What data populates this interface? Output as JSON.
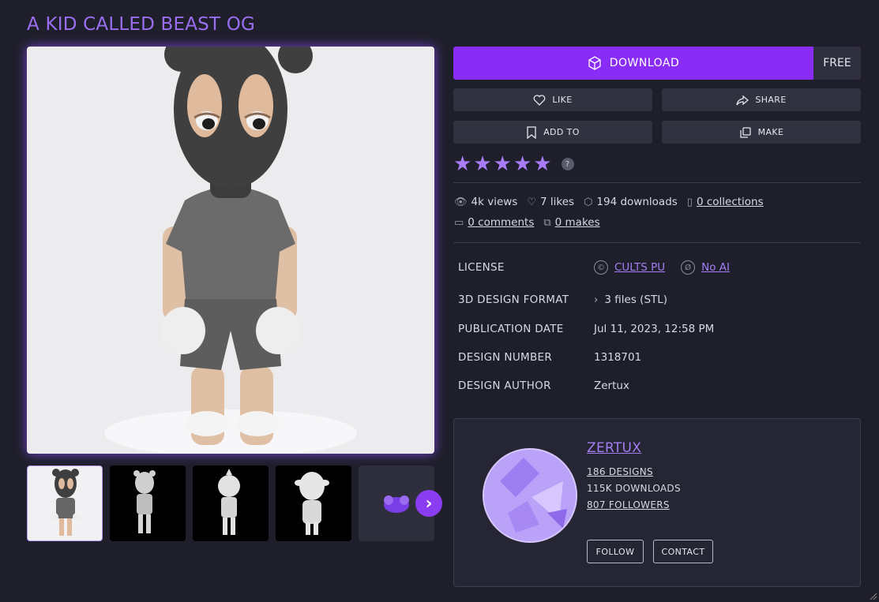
{
  "title": "A KID CALLED BEAST OG",
  "download": {
    "label": "DOWNLOAD",
    "price": "FREE"
  },
  "actions": {
    "like": "LIKE",
    "share": "SHARE",
    "add_to": "ADD TO",
    "make": "MAKE"
  },
  "rating": {
    "stars": 5,
    "help": "?"
  },
  "stats": {
    "views": "4k views",
    "likes": "7 likes",
    "downloads": "194 downloads",
    "collections": "0 collections",
    "comments": "0 comments",
    "makes": "0 makes"
  },
  "details": {
    "license_label": "LICENSE",
    "license_value": "CULTS PU",
    "license_ai": "No AI",
    "format_label": "3D DESIGN FORMAT",
    "format_value": "3 files (STL)",
    "date_label": "PUBLICATION DATE",
    "date_value": "Jul 11, 2023, 12:58 PM",
    "number_label": "DESIGN NUMBER",
    "number_value": "1318701",
    "author_label": "DESIGN AUTHOR",
    "author_value": "Zertux"
  },
  "author": {
    "name": "ZERTUX",
    "designs": "186 DESIGNS",
    "downloads": "115K DOWNLOADS",
    "followers": "807 FOLLOWERS",
    "follow": "FOLLOW",
    "contact": "CONTACT"
  },
  "colors": {
    "accent": "#8a2cf8",
    "link": "#a47ef5",
    "background": "#1f1f2b"
  }
}
